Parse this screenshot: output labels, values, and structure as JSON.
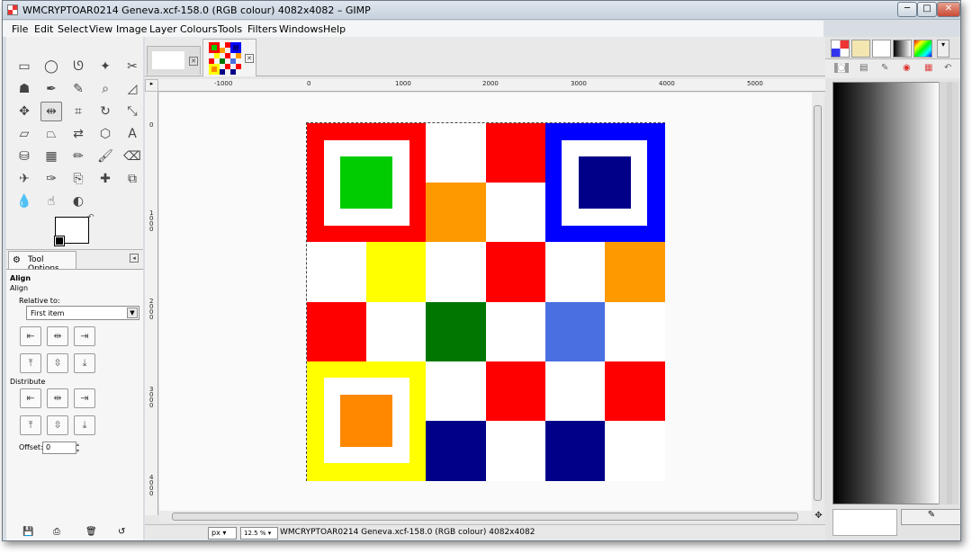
{
  "window": {
    "title": "WMCRYPTOAR0214 Geneva.xcf-158.0 (RGB colour) 4082x4082 – GIMP",
    "minimize_glyph": "─",
    "maximize_glyph": "□",
    "close_glyph": "✕"
  },
  "menubar": [
    "File",
    "Edit",
    "Select",
    "View",
    "Image",
    "Layer",
    "Colours",
    "Tools",
    "Filters",
    "Windows",
    "Help"
  ],
  "toolbox": {
    "tools": [
      {
        "name": "rect-select-icon",
        "glyph": "▭"
      },
      {
        "name": "ellipse-select-icon",
        "glyph": "◯"
      },
      {
        "name": "free-select-icon",
        "glyph": "ᘎ"
      },
      {
        "name": "fuzzy-select-icon",
        "glyph": "✦"
      },
      {
        "name": "scissors-icon",
        "glyph": "✂"
      },
      {
        "name": "foreground-select-icon",
        "glyph": "☗"
      },
      {
        "name": "paths-icon",
        "glyph": "✒"
      },
      {
        "name": "color-picker-icon",
        "glyph": "✎"
      },
      {
        "name": "zoom-icon",
        "glyph": "⌕"
      },
      {
        "name": "measure-icon",
        "glyph": "◿"
      },
      {
        "name": "move-icon",
        "glyph": "✥"
      },
      {
        "name": "align-icon",
        "glyph": "⇹"
      },
      {
        "name": "crop-icon",
        "glyph": "⌗"
      },
      {
        "name": "rotate-icon",
        "glyph": "↻"
      },
      {
        "name": "scale-icon",
        "glyph": "⤡"
      },
      {
        "name": "shear-icon",
        "glyph": "▱"
      },
      {
        "name": "perspective-icon",
        "glyph": "⏢"
      },
      {
        "name": "flip-icon",
        "glyph": "⇄"
      },
      {
        "name": "cage-icon",
        "glyph": "⬡"
      },
      {
        "name": "text-icon",
        "glyph": "A"
      },
      {
        "name": "bucket-fill-icon",
        "glyph": "⛁"
      },
      {
        "name": "blend-icon",
        "glyph": "▦"
      },
      {
        "name": "pencil-icon",
        "glyph": "✏"
      },
      {
        "name": "paintbrush-icon",
        "glyph": "🖌"
      },
      {
        "name": "eraser-icon",
        "glyph": "⌫"
      },
      {
        "name": "airbrush-icon",
        "glyph": "✈"
      },
      {
        "name": "ink-icon",
        "glyph": "✑"
      },
      {
        "name": "clone-icon",
        "glyph": "⎘"
      },
      {
        "name": "heal-icon",
        "glyph": "✚"
      },
      {
        "name": "perspective-clone-icon",
        "glyph": "⧉"
      },
      {
        "name": "blur-icon",
        "glyph": "💧"
      },
      {
        "name": "smudge-icon",
        "glyph": "☝"
      },
      {
        "name": "dodge-burn-icon",
        "glyph": "◐"
      }
    ]
  },
  "tool_options": {
    "tab_label": "Tool Options",
    "heading": "Align",
    "subheading": "Align",
    "relative_to_label": "Relative to:",
    "relative_to_value": "First item",
    "distribute_label": "Distribute",
    "offset_label": "Offset:",
    "offset_value": "0",
    "align_buttons": [
      "⇤",
      "⇹",
      "⇥",
      "⤒",
      "⇳",
      "⤓"
    ],
    "distribute_buttons": [
      "⇤",
      "⇹",
      "⇥",
      "⤒",
      "⇳",
      "⤓"
    ]
  },
  "image_window": {
    "ruler_labels": [
      "-1000",
      "0",
      "1000",
      "2000",
      "3000",
      "4000",
      "5000"
    ],
    "vruler_labels": [
      "0",
      "1000",
      "2000",
      "3000",
      "4000"
    ],
    "status_unit": "px",
    "status_zoom": "12.5 %",
    "status_text": "WMCRYPTOAR0214 Geneva.xcf-158.0 (RGB colour) 4082x4082"
  },
  "artwork_colors": {
    "red": "#ff0000",
    "white": "#ffffff",
    "green": "#00cc00",
    "darkgreen": "#007700",
    "blue": "#0000ff",
    "navy": "#000088",
    "orange": "#ff9900",
    "darkorange": "#ff8800",
    "yellow": "#ffff00",
    "cornflower": "#4a6fe0"
  },
  "dock": {
    "bottom_button_glyph": "✎"
  }
}
